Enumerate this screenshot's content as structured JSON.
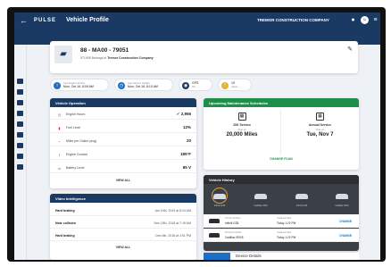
{
  "app": {
    "logo": "PULSE",
    "title": "Vehicle Profile",
    "company": "TREMOR CONSTRUCTION COMPANY"
  },
  "vehicle": {
    "name": "88 - MA00 - 79051",
    "sub_id": "971905",
    "sub_text": "Belongs to",
    "owner": "Tremor Construction Company"
  },
  "status_pills": [
    {
      "label": "Last Engine Activity",
      "value": "Mon, Oct 16, 8:09 AM",
      "color": "#1b6fc4",
      "icon": "info-icon"
    },
    {
      "label": "Last Sensor Update",
      "value": "Mon, Oct 16, 8:10 AM",
      "color": "#1b6fc4",
      "icon": "clock-icon"
    },
    {
      "label": "GPS",
      "value": "OK",
      "color": "#1b3a63",
      "icon": "gps-icon"
    },
    {
      "label": "Alerts",
      "value": "15",
      "color": "#e3b13b",
      "icon": "bell-icon"
    }
  ],
  "vehicle_operation": {
    "title": "Vehicle Operation",
    "rows": [
      {
        "label": "Engine Hours",
        "value": "✓ 2,956",
        "icon": "clock-icon",
        "icon_color": "#555"
      },
      {
        "label": "Fuel Level",
        "value": "12%",
        "icon": "fuel-icon",
        "icon_color": "#d33"
      },
      {
        "label": "Miles per Gallon (avg)",
        "value": "20",
        "icon": "gauge-icon",
        "icon_color": "#555"
      },
      {
        "label": "Engine Coolant",
        "value": "185°F",
        "icon": "thermometer-icon",
        "icon_color": "#555"
      },
      {
        "label": "Battery Level",
        "value": "85 V",
        "icon": "battery-icon",
        "icon_color": "#555"
      }
    ],
    "view_all": "VIEW ALL"
  },
  "video_intelligence": {
    "title": "Video Intelligence",
    "rows": [
      {
        "label": "Hard braking",
        "value": "Jan 10th, 2019 at 8:24 AM"
      },
      {
        "label": "Near collision",
        "value": "Dec 15th, 2018 at 7:15 AM"
      },
      {
        "label": "Hard braking",
        "value": "Dec 6th, 2018 at 2:51 PM"
      }
    ],
    "view_all": "VIEW ALL"
  },
  "maintenance": {
    "title": "Upcoming Maintenance Schedules",
    "items": [
      {
        "name": "20K Service",
        "due": "Due at",
        "value": "20,000 Miles"
      },
      {
        "name": "Annual Service",
        "due": "Due on",
        "value": "Tue, Nov 7"
      }
    ],
    "change_plan": "CHANGE PLAN"
  },
  "vehicle_history": {
    "title": "Vehicle History",
    "cars": [
      "Infiniti G35",
      "Cadillac SRX",
      "Infiniti G35",
      "Cadillac SRX"
    ],
    "rows": [
      {
        "l1": "Current Vehicle",
        "v1": "Infiniti G35",
        "l2": "Assigned Date",
        "v2": "Today 1:22 PM",
        "action": "CHANGE"
      },
      {
        "l1": "Previous Vehicle",
        "v1": "Cadillac SRX5",
        "l2": "Assigned Date",
        "v2": "Today 1:22 PM",
        "action": "CHANGE"
      }
    ]
  },
  "device": {
    "title": "Device Details",
    "serial": "387842XRR74X23778"
  }
}
